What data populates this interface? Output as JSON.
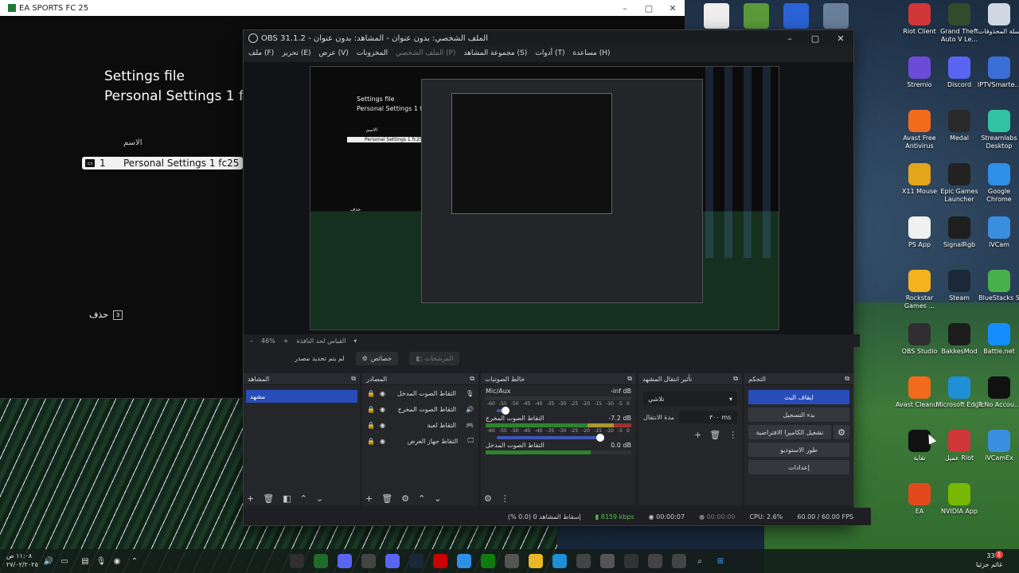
{
  "ea": {
    "title": "EA SPORTS FC 25",
    "settings_title_1": "Settings file",
    "settings_title_2": "Personal Settings 1 f",
    "name_label": "الاسم",
    "item_number": "1",
    "item_name": "Personal Settings 1 fc25",
    "delete_label": "حذف",
    "delete_key": "З"
  },
  "obs": {
    "title": "OBS 31.1.2 - الملف الشخصي: بدون عنوان - المشاهد: بدون عنوان",
    "menu": [
      "ملف (F)",
      "تحرير (E)",
      "عرض (V)",
      "المخزونات",
      "الملف الشخصي (P)",
      "مجموعة المشاهد (S)",
      "أدوات (T)",
      "مساعدة (H)"
    ],
    "preview_nested": {
      "settings_title_1": "Settings file",
      "settings_title_2": "Personal Settings 1 fc",
      "name_label": "الاسم",
      "item_name": "Personal Settings 1 fc25",
      "delete_label": "حذف"
    },
    "zoom": "46%",
    "zoom_fit": "القياس لحد النافذة",
    "no_source": "لم يتم تحديد مصدر",
    "properties_btn": "خصائص",
    "filters_btn": "المرشحات",
    "scenes": {
      "title": "المشاهد",
      "items": [
        "مشهد"
      ]
    },
    "sources": {
      "title": "المصادر",
      "items": [
        {
          "name": "التقاط الصوت المدخل",
          "icon": "mic-icon"
        },
        {
          "name": "التقاط الصوت المخرج",
          "icon": "speaker-icon"
        },
        {
          "name": "التقاط لعبة",
          "icon": "gamepad-icon"
        },
        {
          "name": "التقاط جهاز العرض",
          "icon": "monitor-icon"
        }
      ]
    },
    "mixer": {
      "title": "خالط الصوتيات",
      "scale": [
        "-60",
        "-55",
        "-50",
        "-45",
        "-40",
        "-35",
        "-30",
        "-25",
        "-20",
        "-15",
        "-10",
        "-5",
        "0"
      ],
      "channels": [
        {
          "name": "Mic/Aux",
          "level": "-inf dB",
          "fader": 0.05
        },
        {
          "name": "التقاط الصوت المخرج",
          "level": "-7.2 dB",
          "fader": 0.75
        },
        {
          "name": "التقاط الصوت المدخل",
          "level": "0.0 dB",
          "fader": 1.0
        }
      ]
    },
    "transitions": {
      "title": "تأثير انتقال المشهد",
      "selected": "تلاشي",
      "duration_label": "مدة الانتقال",
      "duration_value": "٣٠٠ ms"
    },
    "controls": {
      "title": "التحكم",
      "stop_stream": "ايقاف البث",
      "start_record": "بدء التسجيل",
      "virtual_camera": "تشغيل الكاميرا الافتراضية",
      "studio_mode": "طور الاستوديو",
      "settings": "إعدادات"
    },
    "status": {
      "dropped": "إسقاط المشاهد 0 (0.0 %)",
      "bitrate": "8159 kbps",
      "stream_time": "00:00:07",
      "record_time": "00:00:00",
      "cpu": "CPU: 2.6%",
      "fps": "60.00 / 60.00 FPS"
    }
  },
  "desktop_icons": [
    {
      "label": "Riot Client",
      "icon": "riot-icon",
      "color": "#d13639"
    },
    {
      "label": "Grand Theft Auto V Le...",
      "icon": "gta-icon",
      "color": "#2f4d2a"
    },
    {
      "label": "سلة المحذوفات",
      "icon": "recycle-bin-icon",
      "color": "#cfd8e0"
    },
    {
      "label": "Stremio",
      "icon": "stremio-icon",
      "color": "#6c4bd6"
    },
    {
      "label": "Discord",
      "icon": "discord-icon",
      "color": "#5865f2"
    },
    {
      "label": "IPTVSmarte...",
      "icon": "iptv-icon",
      "color": "#3a6fd8"
    },
    {
      "label": "Avast Free Antivirus",
      "icon": "avast-icon",
      "color": "#f26b1d"
    },
    {
      "label": "Medal",
      "icon": "medal-icon",
      "color": "#2a2a2a"
    },
    {
      "label": "Streamlabs Desktop",
      "icon": "streamlabs-icon",
      "color": "#31c3a2"
    },
    {
      "label": "X11 Mouse",
      "icon": "x11-mouse-icon",
      "color": "#e2a51b"
    },
    {
      "label": "Epic Games Launcher",
      "icon": "epic-icon",
      "color": "#222222"
    },
    {
      "label": "Google Chrome",
      "icon": "chrome-icon",
      "color": "#2f8fe6"
    },
    {
      "label": "PS App",
      "icon": "ps-app-icon",
      "color": "#f0f0f0"
    },
    {
      "label": "SignalRgb",
      "icon": "signalrgb-icon",
      "color": "#1e1e1e"
    },
    {
      "label": "iVCam",
      "icon": "ivcam-icon",
      "color": "#3a8ee0"
    },
    {
      "label": "Rockstar Games ...",
      "icon": "rockstar-icon",
      "color": "#f4b21d"
    },
    {
      "label": "Steam",
      "icon": "steam-icon",
      "color": "#1b2838"
    },
    {
      "label": "BlueStacks 5",
      "icon": "bluestacks-icon",
      "color": "#47b04b"
    },
    {
      "label": "OBS Studio",
      "icon": "obs-icon",
      "color": "#302e31"
    },
    {
      "label": "BakkesMod",
      "icon": "bakkesmod-icon",
      "color": "#1d1d1d"
    },
    {
      "label": "Battle.net",
      "icon": "battlenet-icon",
      "color": "#148eff"
    },
    {
      "label": "Avast Cleanu...",
      "icon": "avast-cleanup-icon",
      "color": "#f26b1d"
    },
    {
      "label": "Microsoft Edge",
      "icon": "edge-icon",
      "color": "#1f8fd6"
    },
    {
      "label": "TcNo Accou...",
      "icon": "tcno-icon",
      "color": "#111111"
    },
    {
      "label": "تقاية",
      "icon": "app-icon",
      "color": "#111111"
    },
    {
      "label": "عميل Riot",
      "icon": "riot-icon",
      "color": "#d13639"
    },
    {
      "label": "iVCamEx",
      "icon": "ivcam-icon",
      "color": "#3a8ee0"
    },
    {
      "label": "EA",
      "icon": "ea-icon",
      "color": "#e24a1e"
    },
    {
      "label": "NVIDIA App",
      "icon": "nvidia-icon",
      "color": "#76b900"
    }
  ],
  "taskbar": {
    "time": "١١:٠٨ ص",
    "date": "٢٧/٠٢/٢٠٢٥",
    "temperature": "33°C",
    "weather": "غائم جزئيا",
    "notification_count": "1"
  }
}
